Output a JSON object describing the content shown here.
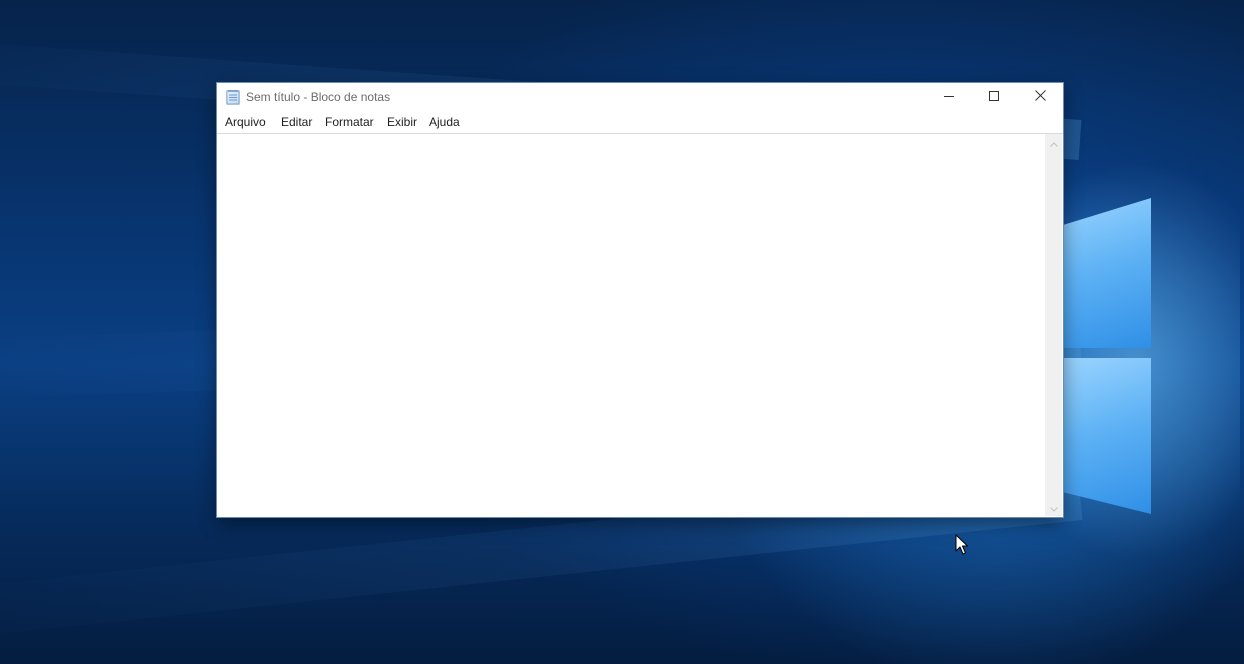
{
  "window": {
    "title": "Sem título - Bloco de notas",
    "app_icon": "notepad-icon",
    "controls": {
      "minimize_icon": "minimize-icon",
      "maximize_icon": "maximize-icon",
      "close_icon": "close-icon"
    }
  },
  "menu": {
    "items": [
      {
        "label": "Arquivo"
      },
      {
        "label": "Editar"
      },
      {
        "label": "Formatar"
      },
      {
        "label": "Exibir"
      },
      {
        "label": "Ajuda"
      }
    ]
  },
  "editor": {
    "content": ""
  },
  "scrollbar": {
    "up_icon": "chevron-up-icon",
    "down_icon": "chevron-down-icon"
  },
  "colors": {
    "desktop_blue": "#0a3f83",
    "logo_blue": "#5fb3f5",
    "window_bg": "#ffffff",
    "title_text": "#6b6b6b"
  }
}
